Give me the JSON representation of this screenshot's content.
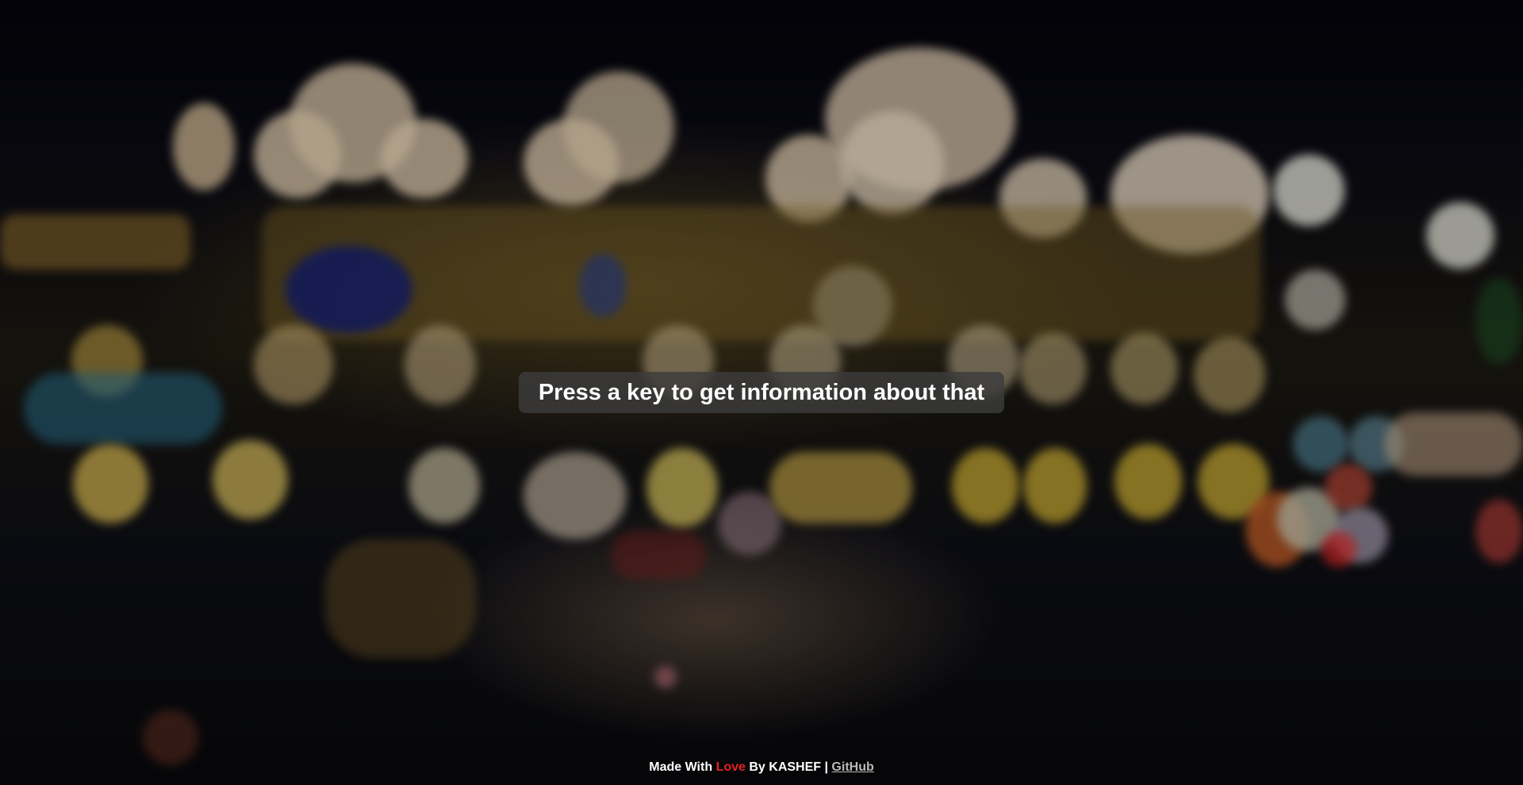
{
  "prompt": {
    "text": "Press a key to get information about that"
  },
  "footer": {
    "made_with": "Made With",
    "love": "Love",
    "by": "By KASHEF |",
    "github_label": "GitHub"
  },
  "colors": {
    "accent_love": "#e4231d",
    "link": "#b9b9b9",
    "overlay": "#3c3c3c"
  },
  "background": {
    "description_icon": "blurred-city-lights-image"
  }
}
